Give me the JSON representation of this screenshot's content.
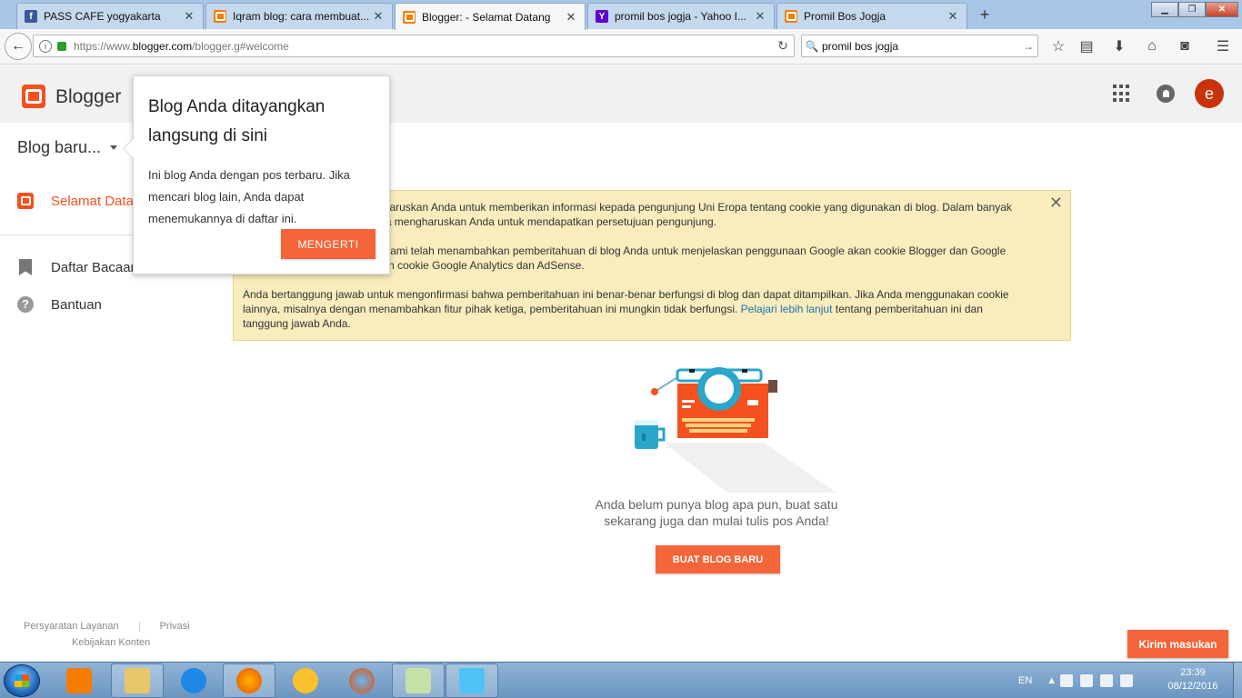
{
  "browser": {
    "tabs": [
      {
        "title": "PASS CAFE yogyakarta",
        "favicon": "facebook-icon",
        "active": false
      },
      {
        "title": "Iqram blog: cara membuat...",
        "favicon": "blogger-icon",
        "active": false
      },
      {
        "title": "Blogger: - Selamat Datang",
        "favicon": "blogger-icon",
        "active": true
      },
      {
        "title": "promil bos jogja - Yahoo I...",
        "favicon": "yahoo-icon",
        "active": false
      },
      {
        "title": "Promil Bos Jogja",
        "favicon": "blogger-icon",
        "active": false
      }
    ],
    "new_tab_label": "+",
    "url_prefix": "https://www.",
    "url_host": "blogger.com",
    "url_path": "/blogger.g#welcome",
    "search_value": "promil bos jogja"
  },
  "app": {
    "logo_text": "Blogger",
    "avatar_letter": "e",
    "blog_selector": "Blog baru...",
    "sidebar": [
      {
        "label": "Selamat Datang",
        "icon": "blogger-icon",
        "accent": "#f4511e"
      },
      {
        "label": "Daftar Bacaan",
        "icon": "bookmark-icon"
      },
      {
        "label": "Bantuan",
        "icon": "help-icon"
      }
    ],
    "footer": {
      "terms": "Persyaratan Layanan",
      "privacy": "Privasi",
      "content_policy": "Kebijakan Konten"
    }
  },
  "popup": {
    "title": "Blog Anda ditayangkan langsung di sini",
    "body": "Ini blog Anda dengan pos terbaru. Jika mencari blog lain, Anda dapat menemukannya di daftar ini.",
    "button": "MENGERTI"
  },
  "notice": {
    "para1": "Undang-undang Eropa mengharuskan Anda untuk memberikan informasi kepada pengunjung Uni Eropa tentang cookie yang digunakan di blog. Dalam banyak kasus, undang-undang ini juga mengharuskan Anda untuk mendapatkan persetujuan pengunjung.",
    "para2": "Sebagai bentuk kemudahan, kami telah menambahkan pemberitahuan di blog Anda untuk menjelaskan penggunaan Google akan cookie Blogger dan Google tertentu, termasuk penggunaan cookie Google Analytics dan AdSense.",
    "para3_before": "Anda bertanggung jawab untuk mengonfirmasi bahwa pemberitahuan ini benar-benar berfungsi di blog dan dapat ditampilkan. Jika Anda menggunakan cookie lainnya, misalnya dengan menambahkan fitur pihak ketiga, pemberitahuan ini mungkin tidak berfungsi. ",
    "link": "Pelajari lebih lanjut",
    "para3_after": " tentang pemberitahuan ini dan tanggung jawab Anda."
  },
  "empty_state": {
    "line1": "Anda belum punya blog apa pun, buat satu",
    "line2": "sekarang juga dan mulai tulis pos Anda!",
    "button": "BUAT BLOG BARU"
  },
  "feedback_button": "Kirim masukan",
  "taskbar": {
    "language": "EN",
    "time": "23:39",
    "date": "08/12/2016"
  },
  "colors": {
    "accent": "#f4663a",
    "notice_bg": "#f9edbe",
    "link": "#1a73a8"
  }
}
